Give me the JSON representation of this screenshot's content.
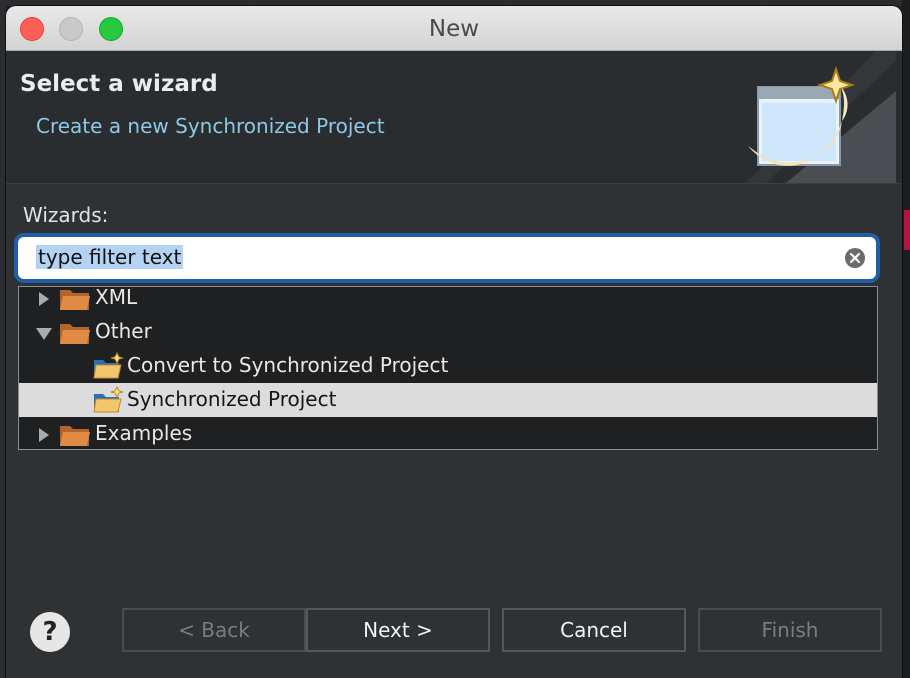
{
  "window": {
    "title": "New"
  },
  "header": {
    "title": "Select a wizard",
    "description": "Create a new Synchronized Project",
    "banner_icon": "wizard-banner-icon"
  },
  "wizards": {
    "label": "Wizards:",
    "filter_value": "type filter text",
    "clear_icon": "clear-circle-x-icon"
  },
  "tree": {
    "items": [
      {
        "label": "XML",
        "level": 0,
        "expanded": false,
        "icon": "folder-icon"
      },
      {
        "label": "Other",
        "level": 0,
        "expanded": true,
        "icon": "folder-icon"
      },
      {
        "label": "Convert to Synchronized Project",
        "level": 1,
        "icon": "new-project-icon"
      },
      {
        "label": "Synchronized Project",
        "level": 1,
        "selected": true,
        "icon": "new-project-icon"
      },
      {
        "label": "Examples",
        "level": 0,
        "expanded": false,
        "icon": "folder-icon"
      }
    ]
  },
  "buttons": {
    "help": "?",
    "back": "< Back",
    "next": "Next >",
    "cancel": "Cancel",
    "finish": "Finish"
  },
  "colors": {
    "accent": "#205ea8",
    "description": "#8fc8e6",
    "selected_row": "#dcdcdc"
  }
}
